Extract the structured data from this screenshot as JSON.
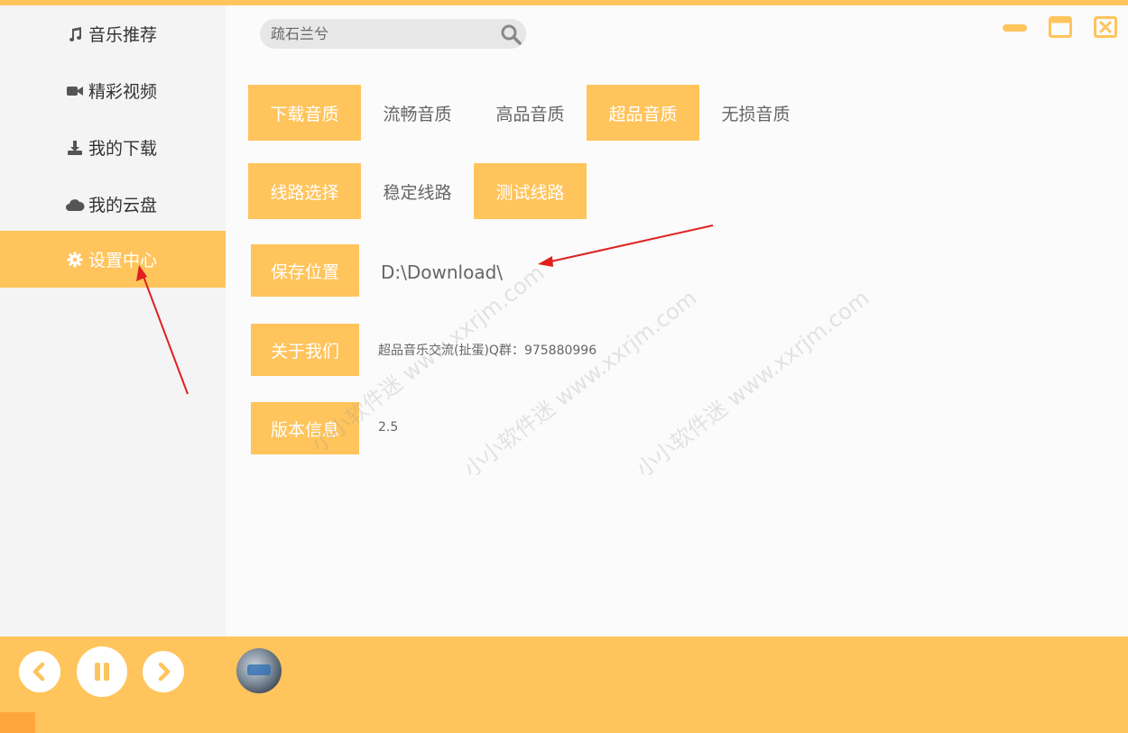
{
  "sidebar": {
    "items": [
      {
        "label": "音乐推荐",
        "icon": "music-note-icon"
      },
      {
        "label": "精彩视频",
        "icon": "video-camera-icon"
      },
      {
        "label": "我的下载",
        "icon": "download-icon"
      },
      {
        "label": "我的云盘",
        "icon": "cloud-icon"
      },
      {
        "label": "设置中心",
        "icon": "gear-icon",
        "active": true
      }
    ]
  },
  "search": {
    "placeholder": "疏石兰兮"
  },
  "settings": {
    "quality": {
      "label": "下载音质",
      "options": [
        "流畅音质",
        "高品音质",
        "超品音质",
        "无损音质"
      ],
      "selected": "超品音质"
    },
    "route": {
      "label": "线路选择",
      "options": [
        "稳定线路",
        "测试线路"
      ],
      "selected": "测试线路"
    },
    "save_location": {
      "label": "保存位置",
      "value": "D:\\Download\\"
    },
    "about": {
      "label": "关于我们",
      "value": "超品音乐交流(扯蛋)Q群：975880996"
    },
    "version": {
      "label": "版本信息",
      "value": "2.5"
    }
  },
  "watermark": "小小软件迷 www.xxrjm.com",
  "colors": {
    "accent": "#ffc45c",
    "annotation": "#e02020"
  }
}
